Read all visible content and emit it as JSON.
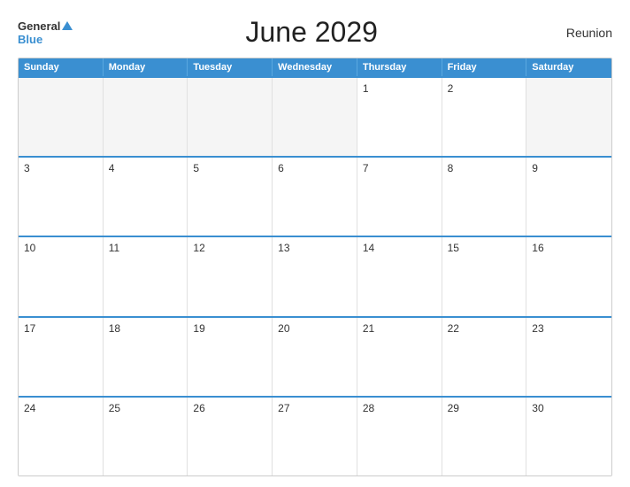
{
  "header": {
    "logo_general": "General",
    "logo_blue": "Blue",
    "title": "June 2029",
    "region": "Reunion"
  },
  "calendar": {
    "days": [
      "Sunday",
      "Monday",
      "Tuesday",
      "Wednesday",
      "Thursday",
      "Friday",
      "Saturday"
    ],
    "rows": [
      [
        "",
        "",
        "",
        "",
        "1",
        "2",
        ""
      ],
      [
        "3",
        "4",
        "5",
        "6",
        "7",
        "8",
        "9"
      ],
      [
        "10",
        "11",
        "12",
        "13",
        "14",
        "15",
        "16"
      ],
      [
        "17",
        "18",
        "19",
        "20",
        "21",
        "22",
        "23"
      ],
      [
        "24",
        "25",
        "26",
        "27",
        "28",
        "29",
        "30"
      ]
    ]
  }
}
